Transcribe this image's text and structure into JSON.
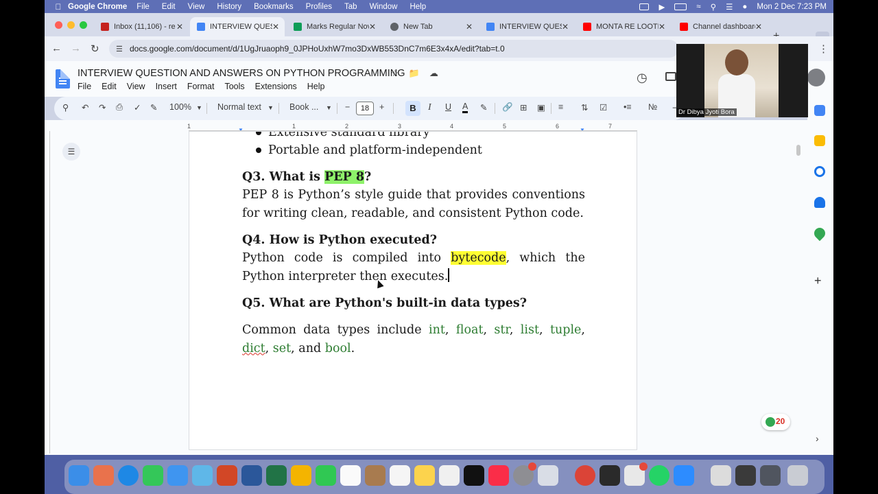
{
  "menubar": {
    "app_name": "Google Chrome",
    "items": [
      "File",
      "Edit",
      "View",
      "History",
      "Bookmarks",
      "Profiles",
      "Tab",
      "Window",
      "Help"
    ],
    "datetime": "Mon 2 Dec  7:23 PM"
  },
  "tabs": [
    {
      "title": "Inbox (11,106) - re",
      "color": "#c5221f"
    },
    {
      "title": "INTERVIEW QUESTI",
      "color": "#4285f4"
    },
    {
      "title": "Marks Regular Nov",
      "color": "#0f9d58"
    },
    {
      "title": "New Tab",
      "color": "#5f6368"
    },
    {
      "title": "INTERVIEW QUESTI",
      "color": "#4285f4"
    },
    {
      "title": "MONTA RE LOOTE",
      "color": "#ff0000"
    },
    {
      "title": "Channel dashboard",
      "color": "#ff0000"
    }
  ],
  "address": {
    "url": "docs.google.com/document/d/1UgJruaoph9_0JPHoUxhW7mo3DxWB553DnC7m6E3x4xA/edit?tab=t.0"
  },
  "doc": {
    "title": "INTERVIEW QUESTION AND ANSWERS ON PYTHON PROGRAMMING",
    "menu": [
      "File",
      "Edit",
      "View",
      "Insert",
      "Format",
      "Tools",
      "Extensions",
      "Help"
    ]
  },
  "toolbar": {
    "zoom": "100%",
    "style": "Normal text",
    "font": "Book ...",
    "font_size": "18",
    "bold": "B",
    "italic": "I",
    "underline": "U",
    "text_color": "A"
  },
  "ruler": {
    "marks": [
      "1",
      "1",
      "2",
      "3",
      "4",
      "5",
      "6",
      "7"
    ]
  },
  "content": {
    "bullet_partial": "Extensive standard library",
    "bullet": "Portable and platform-independent",
    "q3": {
      "prefix": "Q3. What is ",
      "highlight": "PEP 8",
      "suffix": "?",
      "answer": "PEP 8 is Python’s style guide that provides conventions for writing clean, readable, and consistent Python code."
    },
    "q4": {
      "title": "Q4. How is Python executed?",
      "a1": "Python code is compiled into ",
      "highlight": "bytecode",
      "a2": ", which the Python interpreter then executes."
    },
    "q5": {
      "title": "Q5. What are Python's built-in data types?",
      "lead": "Common data types include ",
      "types": [
        "int",
        "float",
        "str",
        "list",
        "tuple",
        "dict",
        "set",
        "bool"
      ],
      "and": " and ",
      "end": "."
    }
  },
  "webcam": {
    "name": "Dr Dibya Jyoti Bora"
  },
  "explore_badge": "20",
  "colors": {
    "menubar": "#5e6fb6",
    "highlight_green": "#8ef26a",
    "highlight_yellow": "#ffff33",
    "datatype": "#2e7d32"
  }
}
